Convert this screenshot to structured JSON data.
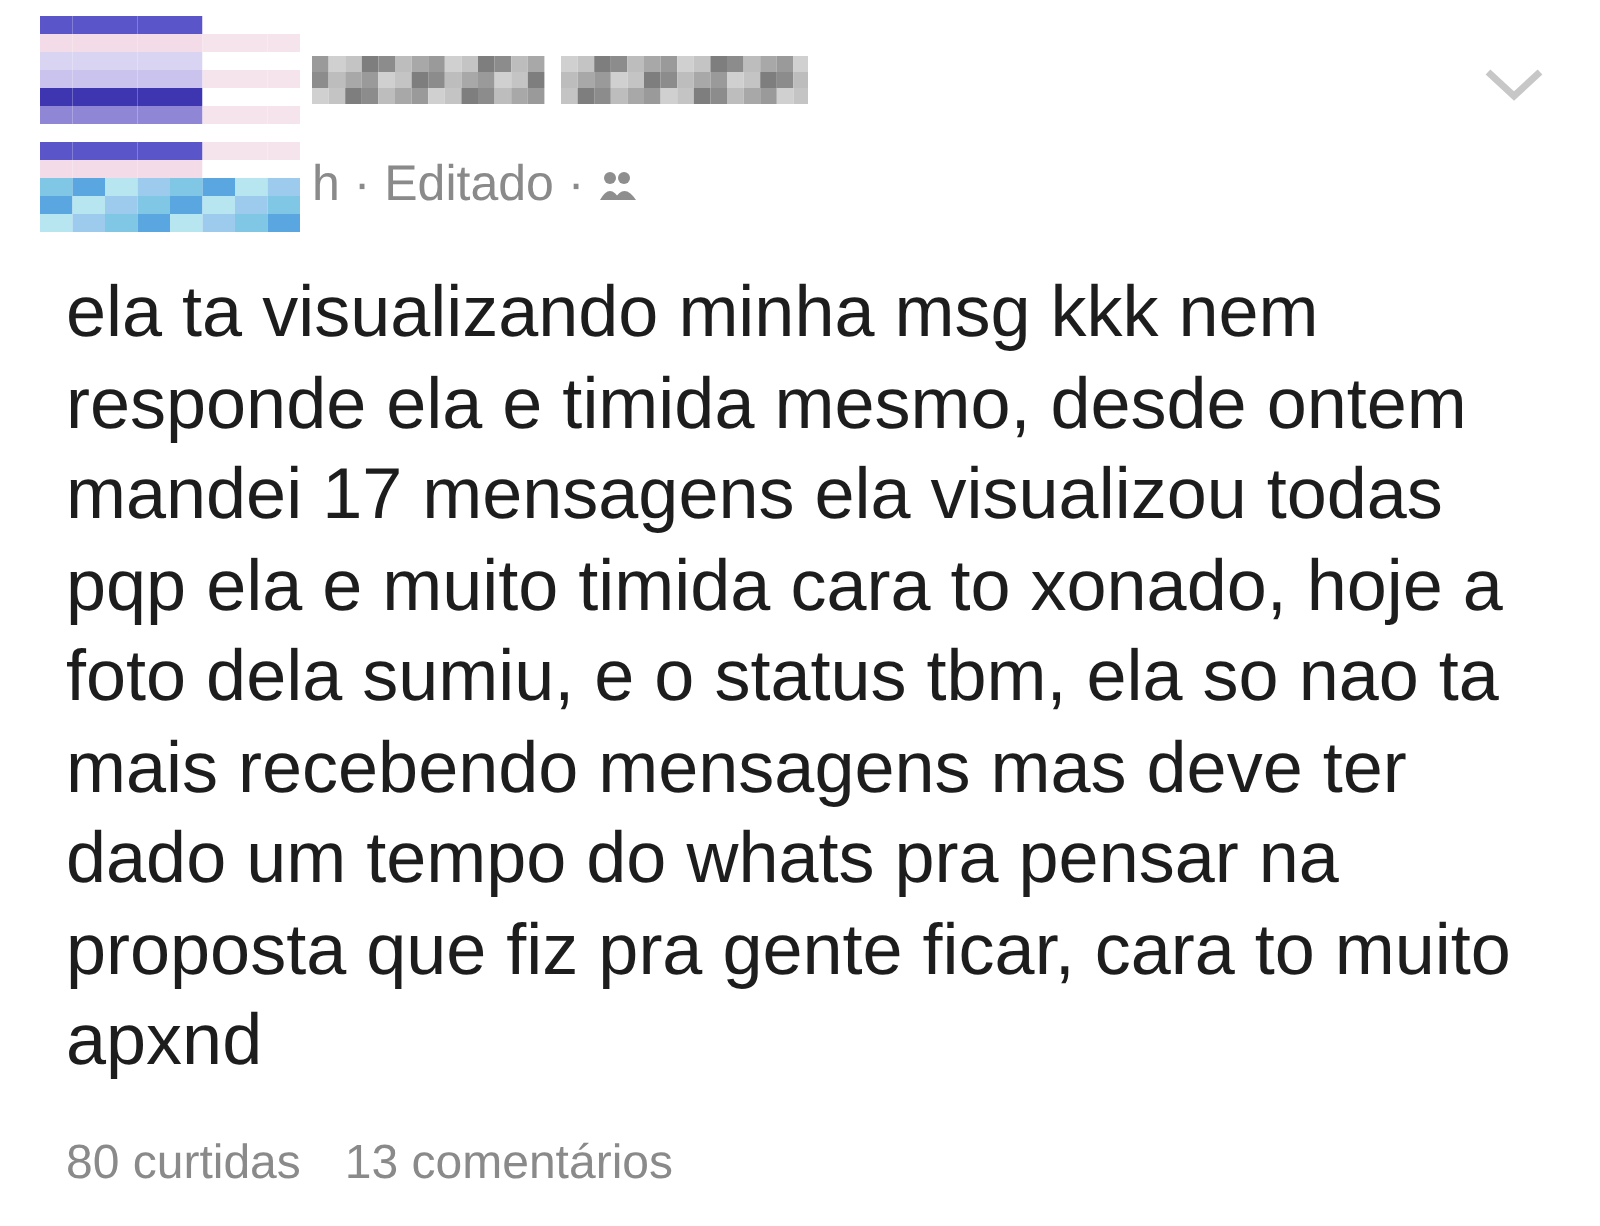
{
  "post": {
    "meta": "h · Editado ·",
    "text": "ela ta visualizando minha msg kkk nem responde ela e timida mesmo, desde ontem mandei 17 mensagens ela visualizou todas pqp ela e muito timida cara to xonado, hoje a foto dela sumiu, e o status tbm, ela so nao ta mais recebendo mensagens mas deve ter dado um tempo do whats pra pensar na proposta que fiz pra gente ficar, cara to muito apxnd",
    "likes": "80 curtidas",
    "comments": "13 comentários"
  }
}
